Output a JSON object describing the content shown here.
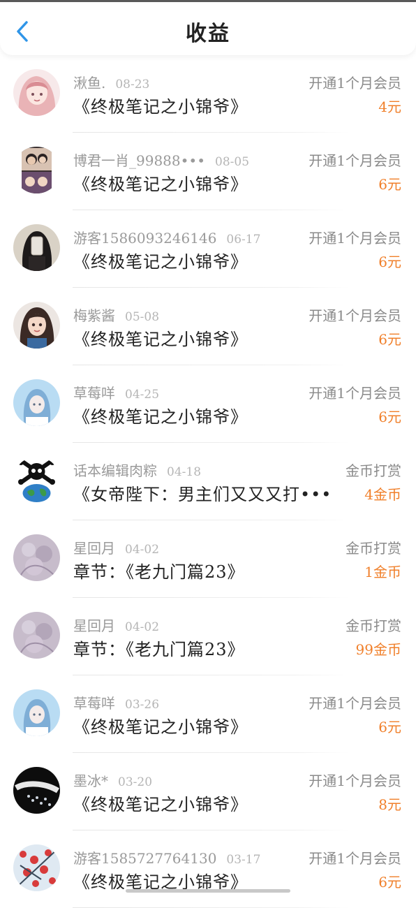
{
  "header": {
    "title": "收益",
    "back_icon": "chevron-left-icon",
    "accent": "#2f95e8"
  },
  "colors": {
    "amount": "#f07f2a",
    "name": "#9a9a9a"
  },
  "records": [
    {
      "user": "湫鱼.",
      "date": "08-23",
      "work": "《终极笔记之小锦爷》",
      "type": "开通1个月会员",
      "amount": "4元",
      "avatar": "pink-hair-girl-avatar"
    },
    {
      "user": "博君一肖_99888•••",
      "date": "08-05",
      "work": "《终极笔记之小锦爷》",
      "type": "开通1个月会员",
      "amount": "6元",
      "avatar": "two-people-photo-avatar"
    },
    {
      "user": "游客1586093246146",
      "date": "06-17",
      "work": "《终极笔记之小锦爷》",
      "type": "开通1个月会员",
      "amount": "6元",
      "avatar": "phone-selfie-avatar"
    },
    {
      "user": "梅紫酱",
      "date": "05-08",
      "work": "《终极笔记之小锦爷》",
      "type": "开通1个月会员",
      "amount": "6元",
      "avatar": "cartoon-girl-avatar"
    },
    {
      "user": "草莓咩",
      "date": "04-25",
      "work": "《终极笔记之小锦爷》",
      "type": "开通1个月会员",
      "amount": "6元",
      "avatar": "blue-sky-girl-avatar"
    },
    {
      "user": "话本编辑肉粽",
      "date": "04-18",
      "work": "《女帝陛下：男主们又又又打•••",
      "type": "金币打赏",
      "amount": "4金币",
      "avatar": "pirate-globe-avatar"
    },
    {
      "user": "星回月",
      "date": "04-02",
      "work": "章节：《老九门篇23》",
      "type": "金币打赏",
      "amount": "1金币",
      "avatar": "purple-blossom-avatar"
    },
    {
      "user": "星回月",
      "date": "04-02",
      "work": "章节：《老九门篇23》",
      "type": "金币打赏",
      "amount": "99金币",
      "avatar": "purple-blossom-avatar"
    },
    {
      "user": "草莓咩",
      "date": "03-26",
      "work": "《终极笔记之小锦爷》",
      "type": "开通1个月会员",
      "amount": "6元",
      "avatar": "blue-sky-girl-avatar"
    },
    {
      "user": "墨冰*",
      "date": "03-20",
      "work": "《终极笔记之小锦爷》",
      "type": "开通1个月会员",
      "amount": "8元",
      "avatar": "dark-jewelry-avatar"
    },
    {
      "user": "游客1585727764130",
      "date": "03-17",
      "work": "《终极笔记之小锦爷》",
      "type": "开通1个月会员",
      "amount": "6元",
      "avatar": "red-blossom-avatar"
    }
  ]
}
